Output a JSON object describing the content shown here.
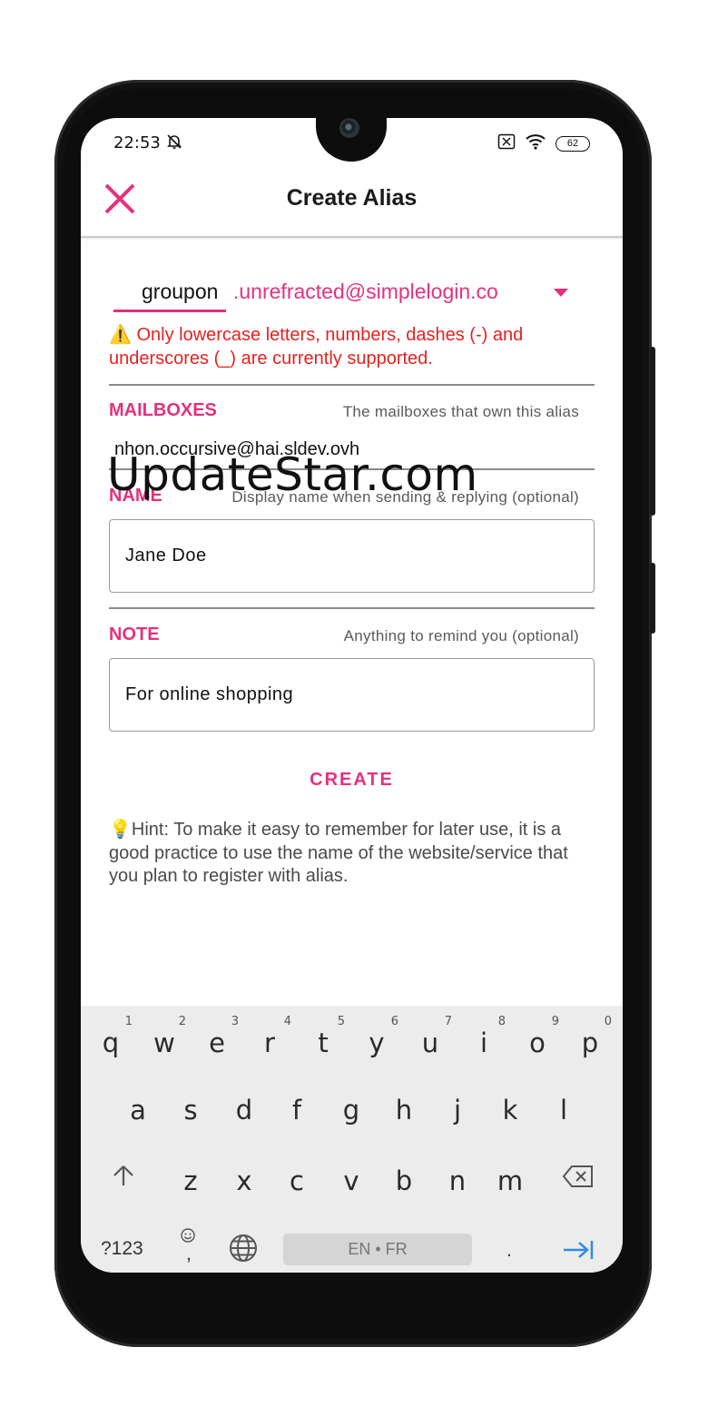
{
  "status_bar": {
    "time": "22:53",
    "battery": "62"
  },
  "app_bar": {
    "title": "Create Alias"
  },
  "alias": {
    "prefix": "groupon",
    "suffix": ".unrefracted@simplelogin.co",
    "error": "⚠️ Only lowercase letters, numbers, dashes (-) and underscores (_) are currently supported."
  },
  "mailboxes": {
    "label": "MAILBOXES",
    "hint": "The mailboxes that own this alias",
    "value": "nhon.occursive@hai.sldev.ovh"
  },
  "name": {
    "label": "NAME",
    "hint": "Display name when sending & replying (optional)",
    "value": "Jane Doe"
  },
  "note": {
    "label": "NOTE",
    "hint": "Anything to remind you (optional)",
    "value": "For online shopping"
  },
  "watermark": "UpdateStar.com",
  "create_button": "CREATE",
  "hint_text": "💡Hint: To make it easy to remember for later use, it is a good practice to use the name of the website/service that you plan to register with alias.",
  "keyboard": {
    "row1": [
      {
        "k": "q",
        "n": "1"
      },
      {
        "k": "w",
        "n": "2"
      },
      {
        "k": "e",
        "n": "3"
      },
      {
        "k": "r",
        "n": "4"
      },
      {
        "k": "t",
        "n": "5"
      },
      {
        "k": "y",
        "n": "6"
      },
      {
        "k": "u",
        "n": "7"
      },
      {
        "k": "i",
        "n": "8"
      },
      {
        "k": "o",
        "n": "9"
      },
      {
        "k": "p",
        "n": "0"
      }
    ],
    "row2": [
      "a",
      "s",
      "d",
      "f",
      "g",
      "h",
      "j",
      "k",
      "l"
    ],
    "row3": [
      "z",
      "x",
      "c",
      "v",
      "b",
      "n",
      "m"
    ],
    "symbols_key": "?123",
    "comma_key": ",",
    "space_label": "EN • FR",
    "period_key": "."
  },
  "colors": {
    "accent": "#e3317f",
    "error": "#e4221f",
    "keyboard_bg": "#ececec"
  },
  "icons": [
    "close-icon",
    "bell-off-icon",
    "sim-icon",
    "wifi-icon",
    "battery-icon",
    "dropdown-arrow-icon",
    "shift-icon",
    "backspace-icon",
    "emoji-icon",
    "globe-icon",
    "enter-icon"
  ]
}
